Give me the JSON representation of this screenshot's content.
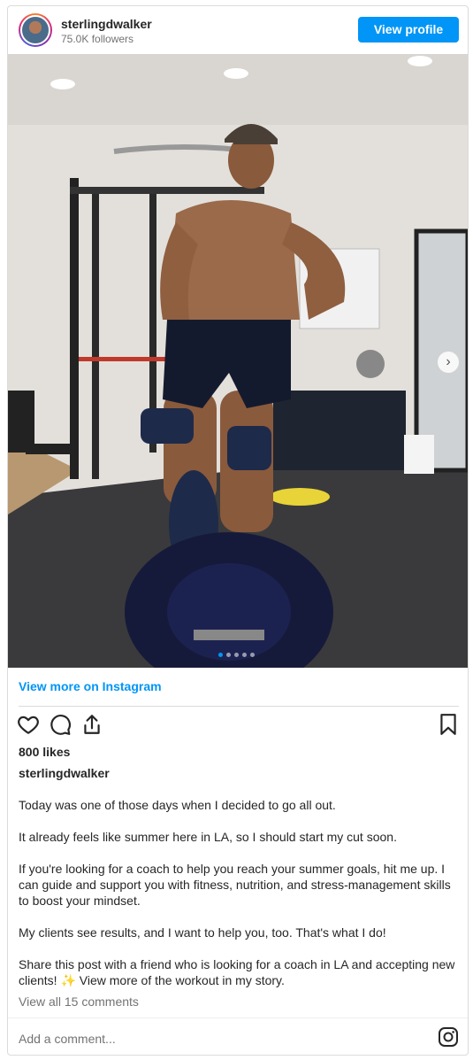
{
  "header": {
    "username": "sterlingdwalker",
    "followers": "75.0K followers",
    "view_profile_label": "View profile"
  },
  "media": {
    "subject": "photo",
    "carousel_slides": 5,
    "active_slide": 1
  },
  "links": {
    "view_more": "View more on Instagram"
  },
  "actions": {
    "icons": [
      "heart-icon",
      "comment-icon",
      "share-icon",
      "bookmark-icon"
    ]
  },
  "post": {
    "likes": "800 likes",
    "caption_username": "sterlingdwalker",
    "caption": [
      "Today was one of those days when I decided to go all out.",
      "It already feels like summer here in LA, so I should start my cut soon.",
      "If you're looking for a coach to help you reach your summer goals, hit me up. I can guide and support you with fitness, nutrition, and stress-management skills to boost your mindset.",
      "My clients see results, and I want to help you, too. That's what I do!",
      "Share this post with a friend who is looking for a coach in LA and accepting new clients! ✨ View more of the workout in my story."
    ],
    "view_comments": "View all 15 comments"
  },
  "comment": {
    "placeholder": "Add a comment..."
  },
  "colors": {
    "accent": "#0095f6",
    "text": "#262626",
    "muted": "#737373",
    "border": "#dbdbdb"
  }
}
